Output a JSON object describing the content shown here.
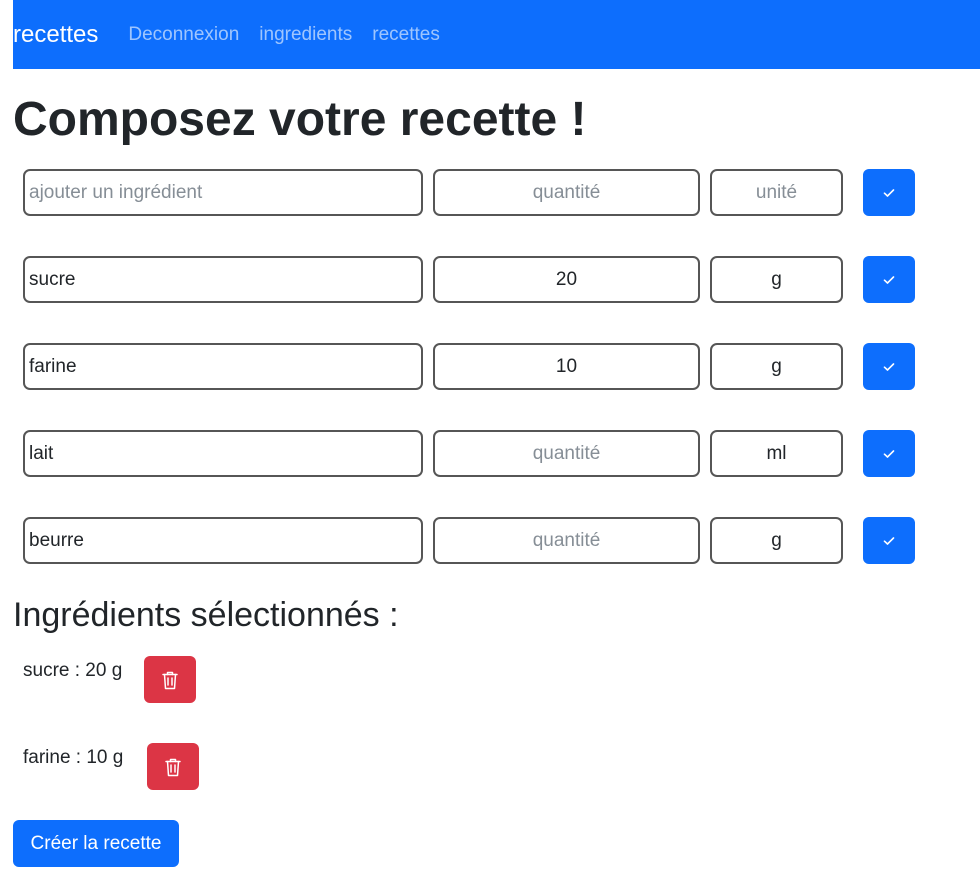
{
  "navbar": {
    "brand": "recettes",
    "links": [
      "Deconnexion",
      "ingredients",
      "recettes"
    ]
  },
  "page_title": "Composez votre recette !",
  "ingredient_rows": [
    {
      "name": "",
      "name_placeholder": "ajouter un ingrédient",
      "quantity": "",
      "quantity_placeholder": "quantité",
      "unit": "",
      "unit_placeholder": "unité"
    },
    {
      "name": "sucre",
      "name_placeholder": "ajouter un ingrédient",
      "quantity": "20",
      "quantity_placeholder": "quantité",
      "unit": "g",
      "unit_placeholder": "unité"
    },
    {
      "name": "farine",
      "name_placeholder": "ajouter un ingrédient",
      "quantity": "10",
      "quantity_placeholder": "quantité",
      "unit": "g",
      "unit_placeholder": "unité"
    },
    {
      "name": "lait",
      "name_placeholder": "ajouter un ingrédient",
      "quantity": "",
      "quantity_placeholder": "quantité",
      "unit": "ml",
      "unit_placeholder": "unité"
    },
    {
      "name": "beurre",
      "name_placeholder": "ajouter un ingrédient",
      "quantity": "",
      "quantity_placeholder": "quantité",
      "unit": "g",
      "unit_placeholder": "unité"
    }
  ],
  "selected_title": "Ingrédients sélectionnés :",
  "selected": [
    "sucre : 20 g",
    "farine : 10 g"
  ],
  "create_button": "Créer la recette",
  "colors": {
    "primary": "#0d6efd",
    "danger": "#dc3545"
  },
  "icons": {
    "confirm": "check-icon",
    "delete": "trash-icon"
  }
}
